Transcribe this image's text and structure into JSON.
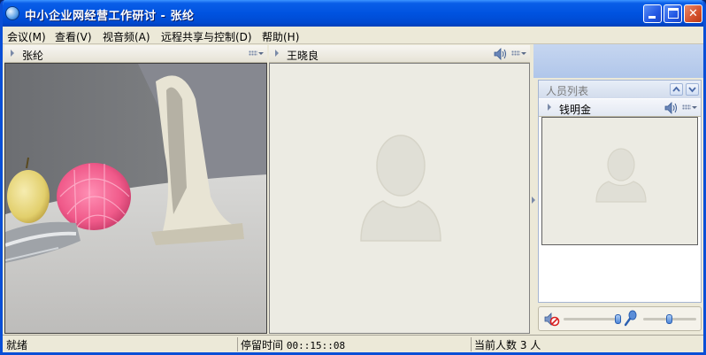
{
  "window": {
    "title": "中小企业网经营工作研讨 - 张纶",
    "minimize_label": "",
    "close_label": "✕"
  },
  "menu": [
    {
      "label": "会议(M)"
    },
    {
      "label": "查看(V)"
    },
    {
      "label": "视音频(A)"
    },
    {
      "label": "远程共享与控制(D)"
    },
    {
      "label": "帮助(H)"
    }
  ],
  "panels": {
    "left_name": "张纶",
    "middle_name": "王晓良"
  },
  "members": {
    "title": "人员列表",
    "items": [
      {
        "name": "钱明金"
      }
    ]
  },
  "status": {
    "state": "就绪",
    "stay_label": "停留时间",
    "stay_time": "00::15::08",
    "count_text": "当前人数 3 人"
  },
  "icons": {
    "app": "globe-icon",
    "speaker": "speaker-icon",
    "panel_menu": "grid-menu-icon",
    "mute": "speaker-mute-icon",
    "microphone": "microphone-icon",
    "avatar": "user-silhouette-icon"
  },
  "colors": {
    "titlebar": "#0053e0",
    "window_bg": "#ece9d8",
    "video_placeholder": "#ecebe3"
  }
}
